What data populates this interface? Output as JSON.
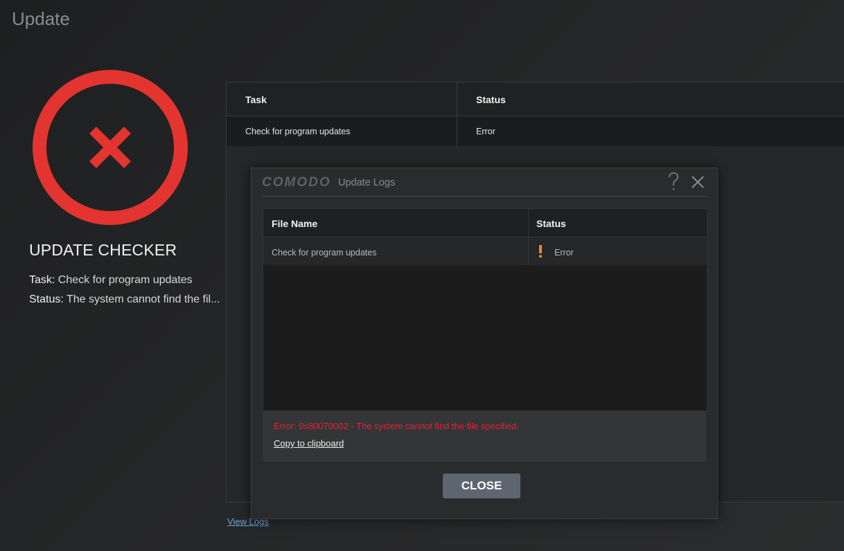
{
  "page": {
    "title": "Update"
  },
  "checker": {
    "title": "UPDATE CHECKER",
    "task_key": "Task:",
    "task_value": "Check for program updates",
    "status_key": "Status:",
    "status_value": "The system cannot find the fil...",
    "icon": "error-x-icon",
    "accent_color": "#e3342f"
  },
  "task_table": {
    "headers": [
      "Task",
      "Status"
    ],
    "rows": [
      [
        "Check for program updates",
        "Error"
      ]
    ]
  },
  "view_logs_label": "View Logs",
  "dialog": {
    "brand": "COMODO",
    "title": "Update Logs",
    "help_icon": "question-mark-icon",
    "close_icon": "close-icon",
    "table": {
      "headers": [
        "File Name",
        "Status"
      ],
      "rows": [
        {
          "file": "Check for program updates",
          "status": "Error",
          "status_icon": "warning-icon"
        }
      ]
    },
    "error_message": "Error: 0x80070002 - The system cannot find the file specified.",
    "error_color": "#e0233a",
    "copy_label": "Copy to clipboard",
    "close_button_label": "CLOSE"
  }
}
